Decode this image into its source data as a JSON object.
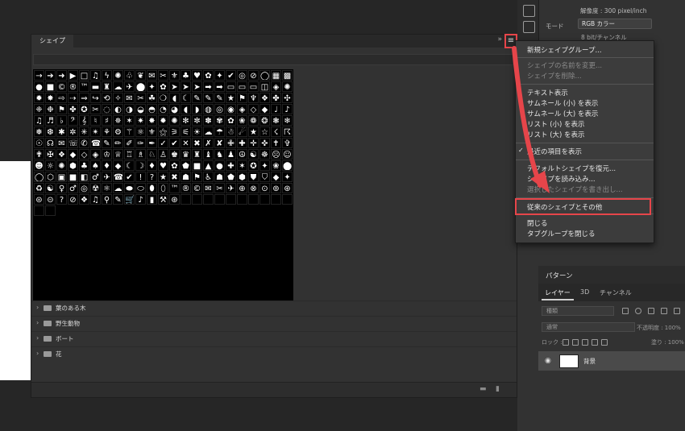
{
  "document": {
    "resolution": "解像度 : 300 pixel/inch",
    "mode_label": "モード",
    "mode_value": "RGB カラー",
    "bit_value": "8 bit/チャンネル"
  },
  "shapes_panel": {
    "tab_label": "シェイプ",
    "collapse_icon": "»",
    "menu_icon": "≡",
    "grid_symbols": [
      "→",
      "➔",
      "➜",
      "▶",
      "□",
      "♫",
      "ϟ",
      "✺",
      "♧",
      "❦",
      "✉",
      "✂",
      "⚜",
      "♣",
      "♥",
      "✿",
      "✦",
      "✔",
      "◎",
      "⊘",
      "◯",
      "▦",
      "▩",
      "●",
      "■",
      "©",
      "®",
      "™",
      "▬",
      "♜",
      "☁",
      "✈",
      "⬤",
      "✦",
      "✿",
      "➤",
      "➤",
      "➤",
      "➡",
      "➡",
      "▭",
      "▭",
      "▭",
      "◫",
      "◈",
      "✺",
      "✹",
      "✸",
      "⇨",
      "⇢",
      "⇒",
      "↪",
      "⟲",
      "✧",
      "✉",
      "✂",
      "☘",
      "❍",
      "◖",
      "☾",
      "✎",
      "✎",
      "✎",
      "★",
      "⚑",
      "♆",
      "❖",
      "✤",
      "✣",
      "❈",
      "❉",
      "⚑",
      "✤",
      "✪",
      "✂",
      "◌",
      "◐",
      "◑",
      "◒",
      "◓",
      "◔",
      "◕",
      "◖",
      "◗",
      "◍",
      "◎",
      "◉",
      "◈",
      "◇",
      "◆",
      "♩",
      "♪",
      "♫",
      "♬",
      "♭",
      "𝄢",
      "𝄞",
      "♮",
      "♯",
      "✵",
      "✶",
      "✷",
      "✸",
      "✹",
      "✺",
      "✻",
      "✼",
      "✽",
      "✾",
      "✿",
      "❀",
      "❁",
      "❂",
      "❃",
      "❄",
      "❅",
      "❆",
      "✱",
      "✲",
      "✳",
      "✴",
      "⚘",
      "⚙",
      "⚚",
      "⚛",
      "⚜",
      "⚝",
      "⚞",
      "⚟",
      "☀",
      "☁",
      "☂",
      "☃",
      "☄",
      "★",
      "☆",
      "☇",
      "☈",
      "☉",
      "☊",
      "✉",
      "☏",
      "✆",
      "☎",
      "✎",
      "✏",
      "✐",
      "✑",
      "✒",
      "✓",
      "✔",
      "✕",
      "✖",
      "✗",
      "✘",
      "✙",
      "✚",
      "✛",
      "✜",
      "✝",
      "✞",
      "✟",
      "✠",
      "❖",
      "◆",
      "◇",
      "◈",
      "♔",
      "♕",
      "♖",
      "♗",
      "♘",
      "♙",
      "♚",
      "♛",
      "♜",
      "♝",
      "♞",
      "♟",
      "☮",
      "☯",
      "☸",
      "☹",
      "☺",
      "☻",
      "☼",
      "✺",
      "⬢",
      "♣",
      "♠",
      "♦",
      "◆",
      "☾",
      "☽",
      "♦",
      "♥",
      "✿",
      "⬟",
      "■",
      "▲",
      "●",
      "✚",
      "✶",
      "✪",
      "✦",
      "❀",
      "⬤",
      "◯",
      "⬡",
      "▣",
      "■",
      "◧",
      "♂",
      "✈",
      "☎",
      "✔",
      "!",
      "?",
      "★",
      "✖",
      "☗",
      "⚑",
      "♿",
      "☗",
      "⬟",
      "⬢",
      "⛊",
      "⛉",
      "◆",
      "✦",
      "♻",
      "☯",
      "♀",
      "♂",
      "◎",
      "☢",
      "⚛",
      "☁",
      "⬬",
      "⬭",
      "⬮",
      "⬯",
      "™",
      "®",
      "©",
      "✉",
      "✂",
      "✈",
      "⊕",
      "⊗",
      "⊙",
      "⊚",
      "⊛",
      "⊜",
      "⊝",
      "?",
      "⊘",
      "❖",
      "♫",
      "⚲",
      "✎",
      "🛒",
      "♪",
      "▮",
      "⚒",
      "⊛",
      "",
      "",
      "",
      "",
      "",
      "",
      "",
      "",
      "",
      "",
      "",
      ""
    ],
    "groups": [
      {
        "label": "葉のある木"
      },
      {
        "label": "野生動物"
      },
      {
        "label": "ボート"
      },
      {
        "label": "花"
      }
    ],
    "footer_icons": [
      "folder-icon",
      "trash-icon"
    ]
  },
  "context_menu": {
    "items": [
      {
        "label": "新規シェイプグループ...",
        "disabled": false,
        "checked": false
      },
      {
        "label": "シェイプの名前を変更...",
        "disabled": true,
        "checked": false
      },
      {
        "label": "シェイプを削除...",
        "disabled": true,
        "checked": false
      },
      {
        "label": "テキスト表示",
        "disabled": false,
        "checked": false
      },
      {
        "label": "サムネール (小) を表示",
        "disabled": false,
        "checked": true
      },
      {
        "label": "サムネール (大) を表示",
        "disabled": false,
        "checked": false
      },
      {
        "label": "リスト (小) を表示",
        "disabled": false,
        "checked": false
      },
      {
        "label": "リスト (大) を表示",
        "disabled": false,
        "checked": false
      },
      {
        "label": "最近の項目を表示",
        "disabled": false,
        "checked": true
      },
      {
        "label": "デフォルトシェイプを復元...",
        "disabled": false,
        "checked": false
      },
      {
        "label": "シェイプを読み込み...",
        "disabled": false,
        "checked": false
      },
      {
        "label": "選択したシェイプを書き出し...",
        "disabled": true,
        "checked": false
      },
      {
        "label": "従来のシェイプとその他",
        "disabled": false,
        "checked": false
      },
      {
        "label": "閉じる",
        "disabled": false,
        "checked": false
      },
      {
        "label": "タブグループを閉じる",
        "disabled": false,
        "checked": false
      }
    ]
  },
  "pattern_panel": {
    "title": "パターン"
  },
  "layers_panel": {
    "tabs": [
      "レイヤー",
      "3D",
      "チャンネル"
    ],
    "filter_label": "種類",
    "blend_mode": "通常",
    "opacity_label": "不透明度 : 100%",
    "lock_label": "ロック :",
    "fill_label": "塗り : 100%",
    "layer_name": "背景"
  },
  "colors": {
    "highlight": "#e6454a",
    "panel_bg": "#323232",
    "menu_bg": "#3c3c3c"
  }
}
